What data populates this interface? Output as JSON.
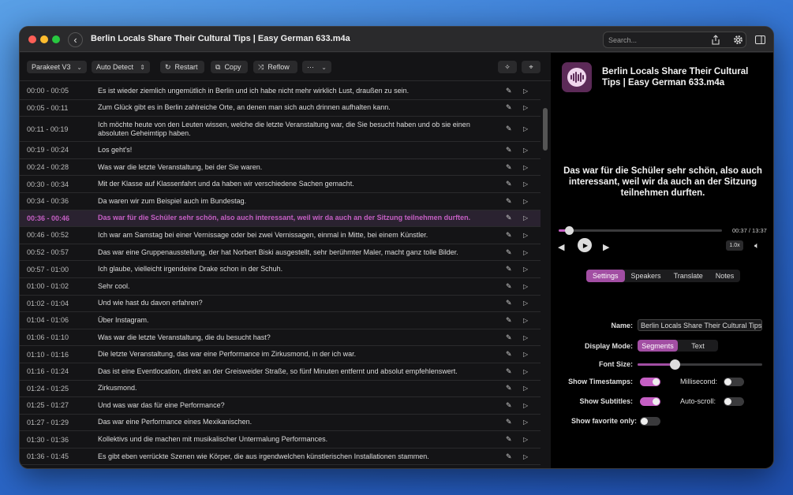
{
  "window": {
    "title": "Berlin Locals Share Their Cultural Tips  |  Easy German 633.m4a",
    "search_placeholder": "Search..."
  },
  "toolbar": {
    "model": "Parakeet V3",
    "language": "Auto Detect",
    "restart": "Restart",
    "copy": "Copy",
    "reflow": "Reflow",
    "more": "···"
  },
  "rows": [
    {
      "ts": "00:00 - 00:05",
      "text": "Es ist wieder ziemlich ungemütlich in Berlin und ich habe nicht mehr wirklich Lust, draußen zu sein."
    },
    {
      "ts": "00:05 - 00:11",
      "text": "Zum Glück gibt es in Berlin zahlreiche Orte, an denen man sich auch drinnen aufhalten kann."
    },
    {
      "ts": "00:11 - 00:19",
      "text": "Ich möchte heute von den Leuten wissen, welche die letzte Veranstaltung war, die Sie besucht haben und ob sie einen absoluten Geheimtipp haben."
    },
    {
      "ts": "00:19 - 00:24",
      "text": "Los geht's!"
    },
    {
      "ts": "00:24 - 00:28",
      "text": "Was war die letzte Veranstaltung, bei der Sie waren."
    },
    {
      "ts": "00:30 - 00:34",
      "text": "Mit der Klasse auf Klassenfahrt und da haben wir verschiedene Sachen gemacht."
    },
    {
      "ts": "00:34 - 00:36",
      "text": "Da waren wir zum Beispiel auch im Bundestag."
    },
    {
      "ts": "00:36 - 00:46",
      "text": "Das war für die Schüler sehr schön, also auch interessant, weil wir da auch an der Sitzung teilnehmen durften."
    },
    {
      "ts": "00:46 - 00:52",
      "text": "Ich war am Samstag bei einer Vernissage oder bei zwei Vernissagen, einmal in Mitte, bei einem Künstler."
    },
    {
      "ts": "00:52 - 00:57",
      "text": "Das war eine Gruppenausstellung, der hat Norbert Biski ausgestellt, sehr berühmter Maler, macht ganz tolle Bilder."
    },
    {
      "ts": "00:57 - 01:00",
      "text": "Ich glaube, vielleicht irgendeine Drake schon in der Schuh."
    },
    {
      "ts": "01:00 - 01:02",
      "text": "Sehr cool."
    },
    {
      "ts": "01:02 - 01:04",
      "text": "Und wie hast du davon erfahren?"
    },
    {
      "ts": "01:04 - 01:06",
      "text": "Über Instagram."
    },
    {
      "ts": "01:06 - 01:10",
      "text": "Was war die letzte Veranstaltung, die du besucht hast?"
    },
    {
      "ts": "01:10 - 01:16",
      "text": "Die letzte Veranstaltung, das war eine Performance im Zirkusmond, in der ich war."
    },
    {
      "ts": "01:16 - 01:24",
      "text": "Das ist eine Eventlocation, direkt an der Greisweider Straße, so fünf Minuten entfernt und absolut empfehlenswert."
    },
    {
      "ts": "01:24 - 01:25",
      "text": "Zirkusmond."
    },
    {
      "ts": "01:25 - 01:27",
      "text": "Und was war das für eine Performance?"
    },
    {
      "ts": "01:27 - 01:29",
      "text": "Das war eine Performance eines Mexikanischen."
    },
    {
      "ts": "01:30 - 01:36",
      "text": "Kollektivs und die machen mit musikalischer Untermalung Performances."
    },
    {
      "ts": "01:36 - 01:45",
      "text": "Es gibt eben verrückte Szenen wie Körper, die aus irgendwelchen künstlerischen Installationen stammen."
    }
  ],
  "active_row": 7,
  "player": {
    "title": "Berlin Locals Share Their Cultural Tips  |  Easy German 633.m4a",
    "subtitle": "Das war für die Schüler sehr schön, also auch interessant, weil wir da auch an der Sitzung teilnehmen durften.",
    "time": "00:37 / 13:37",
    "progress": 0.045,
    "speed": "1.0x"
  },
  "tabs": [
    "Settings",
    "Speakers",
    "Translate",
    "Notes"
  ],
  "settings": {
    "name_label": "Name:",
    "name_value": "Berlin Locals Share Their Cultural Tips  |",
    "display_mode_label": "Display Mode:",
    "display_modes": [
      "Segments",
      "Text"
    ],
    "font_size_label": "Font Size:",
    "font_size_level": 0.3,
    "show_timestamps_label": "Show Timestamps:",
    "show_timestamps": true,
    "millisecond_label": "Millisecond:",
    "millisecond": false,
    "show_subtitles_label": "Show Subtitles:",
    "show_subtitles": true,
    "autoscroll_label": "Auto-scroll:",
    "autoscroll": false,
    "show_favorite_label": "Show favorite only:",
    "show_favorite": false
  },
  "colors": {
    "accent": "#c55fc4",
    "accent_dark": "#a24ea3"
  }
}
